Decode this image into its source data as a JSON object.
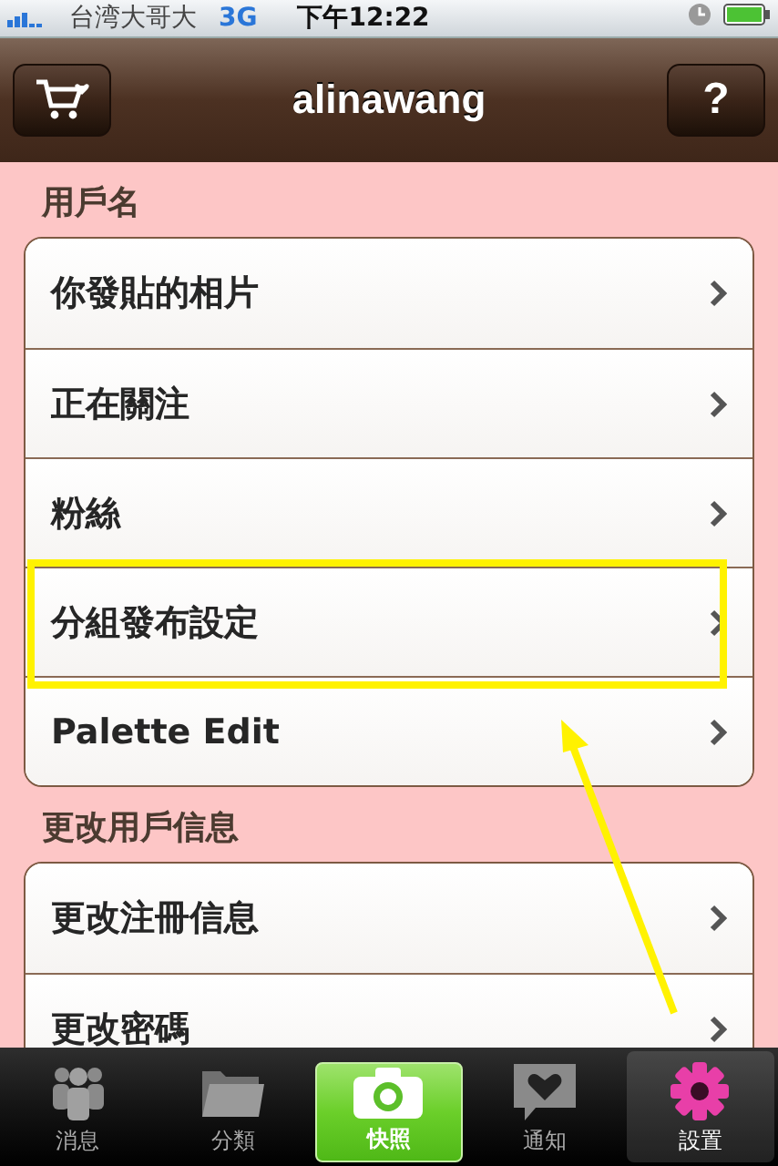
{
  "status_bar": {
    "carrier": "台湾大哥大",
    "network": "3G",
    "time": "下午12:22"
  },
  "nav_bar": {
    "title": "alinawang",
    "help_button": "?"
  },
  "sections": [
    {
      "header": "用戶名",
      "rows": [
        {
          "label": "你發貼的相片"
        },
        {
          "label": "正在關注"
        },
        {
          "label": "粉絲"
        },
        {
          "label": "分組發布設定"
        },
        {
          "label": "Palette Edit"
        }
      ]
    },
    {
      "header": "更改用戶信息",
      "rows": [
        {
          "label": "更改注冊信息"
        },
        {
          "label": "更改密碼"
        }
      ]
    }
  ],
  "tab_bar": [
    {
      "label": "消息",
      "kind": "tab",
      "selected": false
    },
    {
      "label": "分類",
      "kind": "tab",
      "selected": false
    },
    {
      "label": "快照",
      "kind": "camera",
      "selected": false
    },
    {
      "label": "通知",
      "kind": "tab",
      "selected": false
    },
    {
      "label": "設置",
      "kind": "tab",
      "selected": true
    }
  ]
}
